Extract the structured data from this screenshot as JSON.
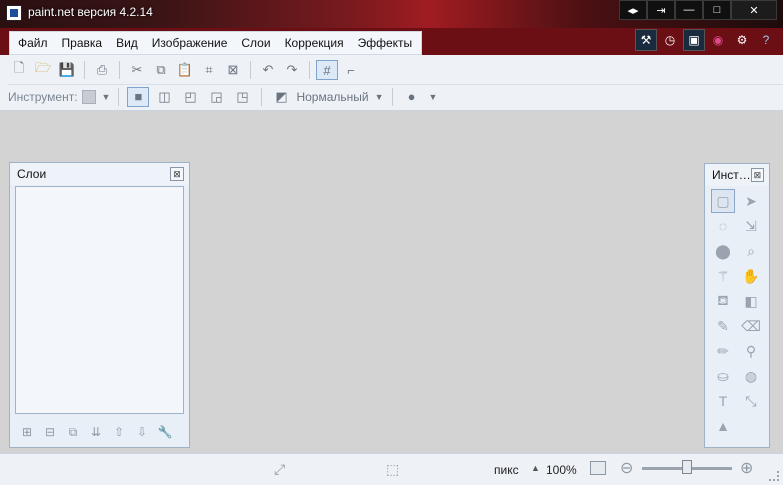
{
  "window": {
    "title": "paint.net версия 4.2.14",
    "buttons": [
      "◂▸",
      "⇥",
      "—",
      "□",
      "✕"
    ]
  },
  "menu": [
    "Файл",
    "Правка",
    "Вид",
    "Изображение",
    "Слои",
    "Коррекция",
    "Эффекты"
  ],
  "quick_icons": {
    "tools": "hammer-icon",
    "history": "history-clock-icon",
    "layers": "layers-icon",
    "colors": "color-wheel-icon",
    "settings": "gear-icon",
    "help": "help-icon"
  },
  "toolbar": {
    "tool_label": "Инструмент:",
    "blend_mode": "Нормальный"
  },
  "layers_panel": {
    "title": "Слои"
  },
  "tools_panel": {
    "title": "Инст…"
  },
  "status": {
    "units": "пикс",
    "zoom": "100%"
  }
}
